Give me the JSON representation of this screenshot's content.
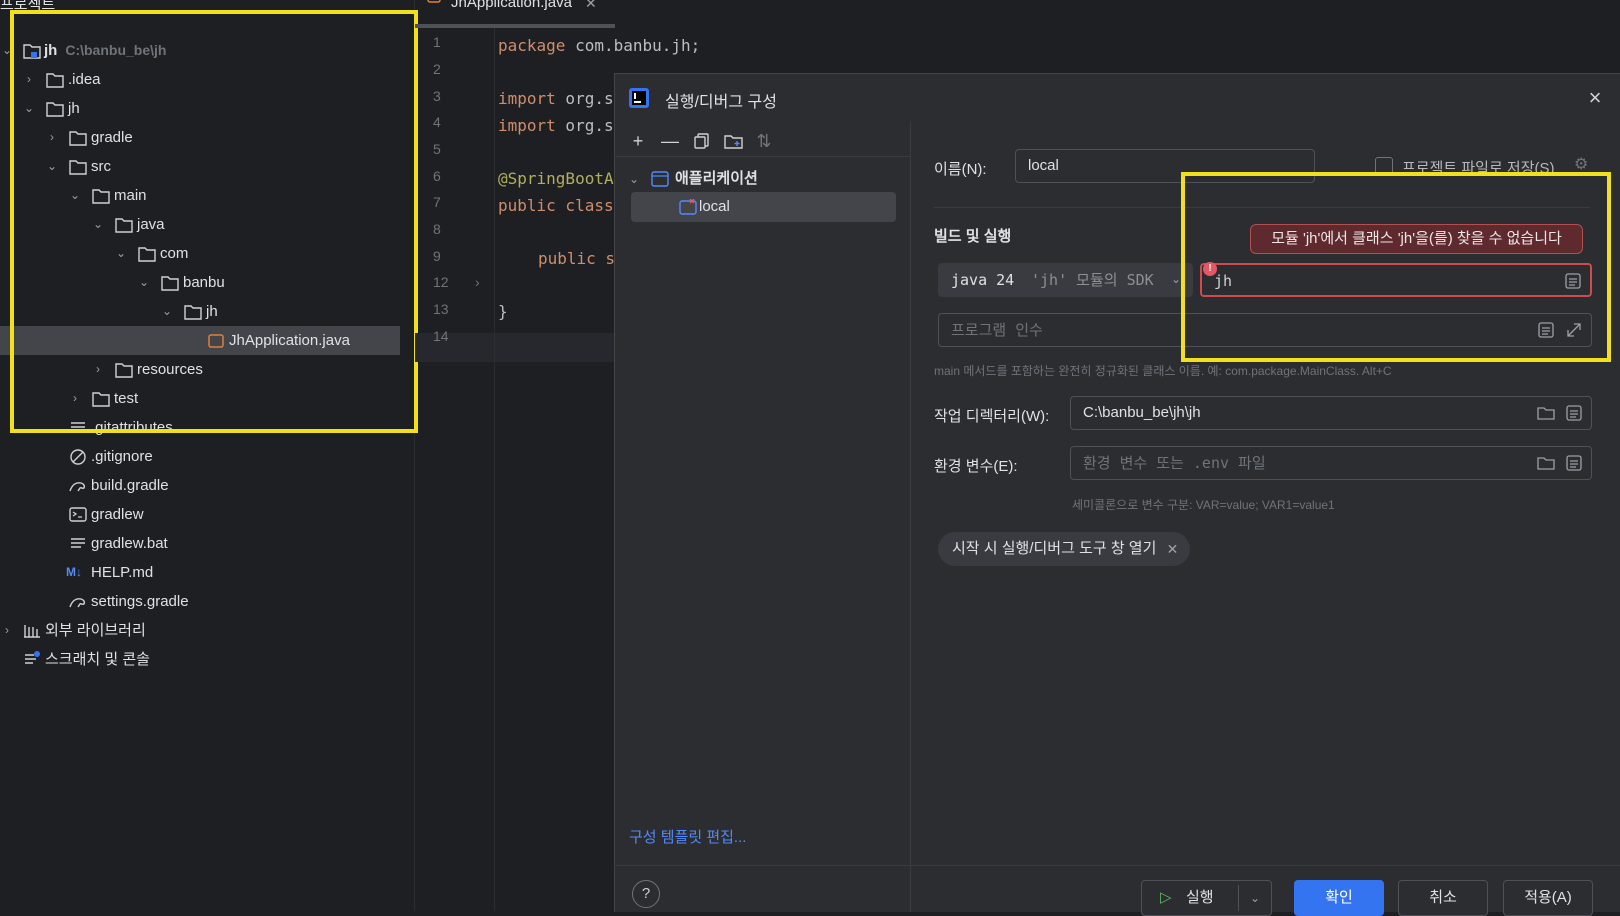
{
  "project_panel": {
    "header_label": "프로젝트",
    "tree": [
      {
        "label": "jh",
        "path": "C:\\banbu_be\\jh",
        "icon": "project-folder-icon"
      },
      {
        "label": ".idea",
        "icon": "folder-icon"
      },
      {
        "label": "jh",
        "icon": "folder-icon"
      },
      {
        "label": "gradle",
        "icon": "folder-icon"
      },
      {
        "label": "src",
        "icon": "folder-icon"
      },
      {
        "label": "main",
        "icon": "folder-icon"
      },
      {
        "label": "java",
        "icon": "folder-icon"
      },
      {
        "label": "com",
        "icon": "folder-icon"
      },
      {
        "label": "banbu",
        "icon": "folder-icon"
      },
      {
        "label": "jh",
        "icon": "folder-icon"
      },
      {
        "label": "JhApplication.java",
        "icon": "java-class-icon"
      },
      {
        "label": "resources",
        "icon": "folder-icon"
      },
      {
        "label": "test",
        "icon": "folder-icon"
      },
      {
        "label": ".gitattributes",
        "icon": "text-file-icon"
      },
      {
        "label": ".gitignore",
        "icon": "ignore-file-icon"
      },
      {
        "label": "build.gradle",
        "icon": "gradle-icon"
      },
      {
        "label": "gradlew",
        "icon": "terminal-file-icon"
      },
      {
        "label": "gradlew.bat",
        "icon": "text-file-icon"
      },
      {
        "label": "HELP.md",
        "icon": "markdown-icon"
      },
      {
        "label": "settings.gradle",
        "icon": "gradle-icon"
      },
      {
        "label": "외부 라이브러리",
        "icon": "library-icon"
      },
      {
        "label": "스크래치 및 콘솔",
        "icon": "scratch-icon"
      }
    ]
  },
  "editor": {
    "tab_label": "JhApplication.java",
    "line_numbers": [
      "1",
      "2",
      "3",
      "4",
      "5",
      "6",
      "7",
      "8",
      "9",
      "12",
      "13",
      "14"
    ],
    "code": {
      "line1_kw": "package",
      "line1_rest": " com.banbu.jh;",
      "line3_kw": "import",
      "line3_rest": " org.s",
      "line4_kw": "import",
      "line4_rest": " org.s",
      "line6": "@SpringBootA",
      "line7_kw": "public class",
      "line9_kw": "public s",
      "line13": "}"
    }
  },
  "dialog": {
    "title": "실행/디버그 구성",
    "toolbar_icons": [
      "add-icon",
      "remove-icon",
      "copy-icon",
      "new-folder-icon",
      "sort-icon"
    ],
    "tree": {
      "group_label": "애플리케이션",
      "item_label": "local"
    },
    "edit_templates_link": "구성 템플릿 편집...",
    "name_label": "이름(N):",
    "name_value": "local",
    "store_as_project_file": "프로젝트 파일로 저장(S)",
    "build_run_section": "빌드 및 실행",
    "sdk_value": "java 24",
    "sdk_hint": "'jh' 모듈의 SDK",
    "main_class_value": "jh",
    "error_tooltip": "모듈 'jh'에서 클래스 'jh'을(를) 찾을 수 없습니다",
    "program_args_placeholder": "프로그램 인수",
    "main_class_hint": "main 메서드를 포함하는 완전히 정규화된 클래스 이름. 예: com.package.MainClass. Alt+C",
    "workdir_label": "작업 디렉터리(W):",
    "workdir_value": "C:\\banbu_be\\jh\\jh",
    "env_label": "환경 변수(E):",
    "env_placeholder": "환경 변수 또는 .env 파일",
    "env_hint": "세미콜론으로 변수 구분: VAR=value; VAR1=value1",
    "chip_label": "시작 시 실행/디버그 도구 창 열기",
    "help_label": "?",
    "run_button": "실행",
    "ok_button": "확인",
    "cancel_button": "취소",
    "apply_button": "적용(A)"
  },
  "colors": {
    "highlight": "#f2e01d",
    "error_border": "#cc4c4f",
    "primary_button": "#3574f0",
    "link": "#548af7"
  }
}
